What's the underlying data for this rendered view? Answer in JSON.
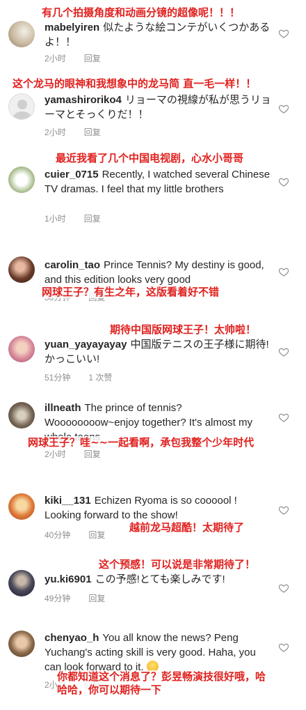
{
  "comments": [
    {
      "annotation": "有几个拍摄角度和动画分镜的超像呢！！！",
      "username": "mabelyiren",
      "text": "似たような絵コンテがいくつかあるよ！！",
      "time": "2小时",
      "reply": "回复",
      "avatar_color": "#c9b9a0"
    },
    {
      "annotation": "这个龙马的眼神和我想象中的龙马简 直一毛一样！！",
      "username": "yamashiroriko4",
      "text": "リョーマの視線が私が思うリョーマとそっくりだ！！",
      "time": "2小时",
      "reply": "回复",
      "avatar_color": "#e8e8e8"
    },
    {
      "annotation": "最近我看了几个中国电视剧，心水小哥哥",
      "username": "cuier_0715",
      "text": "Recently, I watched several Chinese TV dramas. I feel that my little brothers",
      "time": "1小时",
      "reply": "回复",
      "avatar_color": "#7a9a5a"
    },
    {
      "annotation": "网球王子？有生之年，这版看着好不错",
      "username": "carolin_tao",
      "text": "Prince Tennis? My destiny is good, and this edition looks very good",
      "time": "58分钟",
      "reply": "回复",
      "avatar_color": "#6a3b2a"
    },
    {
      "annotation": "期待中国版网球王子！太帅啦！",
      "username": "yuan_yayayayay",
      "text": "中国版テニスの王子様に期待!かっこいい!",
      "time": "51分钟",
      "reply": "1 次赞",
      "avatar_color": "#d88a9a"
    },
    {
      "annotation": "网球王子？哇~~一起看啊，承包我整个少年时代",
      "username": "illneath",
      "text": "The prince of tennis? Woooooooow~enjoy together? It's almost my whole teens",
      "time": "2小时",
      "reply": "回复",
      "avatar_color": "#7a6a5a"
    },
    {
      "annotation": "越前龙马超酷！太期待了",
      "username": "kiki__131",
      "text": "Echizen Ryoma is so coooool ! Looking forward to the show!",
      "time": "40分钟",
      "reply": "回复",
      "avatar_color": "#e07a3a"
    },
    {
      "annotation": "这个预感！可以说是非常期待了！",
      "username": "yu.ki6901",
      "text": "この予感!とても楽しみです!",
      "time": "49分钟",
      "reply": "回复",
      "avatar_color": "#2a3a5a"
    },
    {
      "annotation": "你都知道这个消息了？彭昱畅演技很好哦，哈哈哈，你可以期待一下",
      "username": "chenyao_h",
      "text": "You all know the news? Peng Yuchang's acting skill is very good. Haha, you can look forward to it.",
      "time": "2小时",
      "reply": "回复",
      "avatar_color": "#8a6a4a"
    }
  ],
  "icons": {
    "like": "heart-outline-icon"
  },
  "colors": {
    "annotation": "#e0211f",
    "meta": "#8e8e8e",
    "text": "#262626",
    "heart": "#8e8e8e"
  }
}
